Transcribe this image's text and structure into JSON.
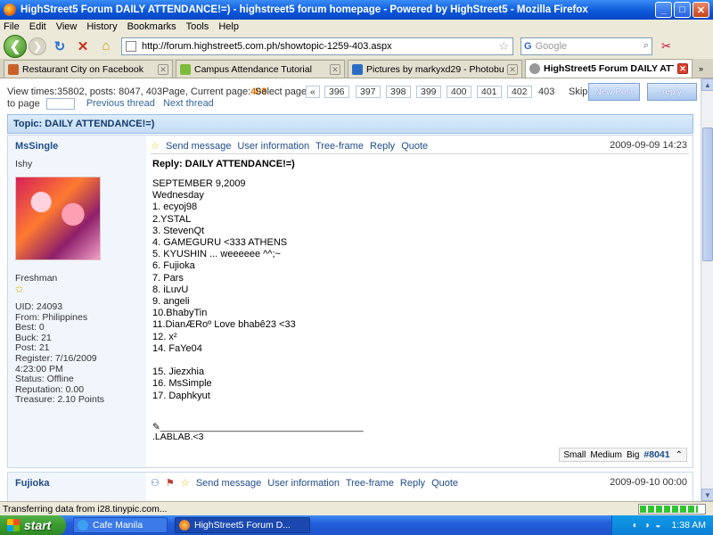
{
  "window": {
    "title": "HighStreet5 Forum DAILY ATTENDANCE!=) - highstreet5 forum homepage - Powered by HighStreet5 - Mozilla Firefox",
    "minimize": "_",
    "maximize": "□",
    "close": "✕"
  },
  "menu": [
    "File",
    "Edit",
    "View",
    "History",
    "Bookmarks",
    "Tools",
    "Help"
  ],
  "nav": {
    "url": "http://forum.highstreet5.com.ph/showtopic-1259-403.aspx",
    "search_placeholder": "Google"
  },
  "tabs": [
    {
      "label": "Restaurant City on Facebook",
      "color": "#c8602a"
    },
    {
      "label": "Campus Attendance Tutorial",
      "color": "#7cbc3a"
    },
    {
      "label": "Pictures by markyxd29 - Photobucket",
      "color": "#2d6cc4"
    },
    {
      "label": "HighStreet5 Forum DAILY ATTEN...",
      "color": "#ffffff"
    }
  ],
  "pager": {
    "view_info_prefix": "View times:35802, posts: 8047, 403Page, Current page:",
    "current_page": "403",
    "select_page_label": "Select page:",
    "first": "«",
    "pages": [
      "396",
      "397",
      "398",
      "399",
      "400",
      "401",
      "402"
    ],
    "current": "403",
    "skip_label": "Skip",
    "to_page_label": "to page",
    "prev_thread": "Previous thread",
    "next_thread": "Next thread",
    "new_post": "New Post",
    "reply": "reply"
  },
  "topic": {
    "title": "Topic: DAILY ATTENDANCE!=)"
  },
  "post1": {
    "username": "MsSingle",
    "subtitle": "Ishy",
    "rank": "Freshman",
    "stats": [
      "UID: 24093",
      "From: Philippines",
      "Best: 0",
      "Buck: 21",
      "Post: 21",
      "Register: 7/16/2009",
      "4:23:00 PM",
      "Status: Offline",
      "Reputation: 0.00",
      "Treasure: 2.10 Points"
    ],
    "actions": [
      "Send message",
      "User information",
      "Tree-frame",
      "Reply",
      "Quote"
    ],
    "date": "2009-09-09 14:23",
    "reply_title": "Reply: DAILY ATTENDANCE!=)",
    "body": "SEPTEMBER 9,2009\nWednesday\n1. ecyoj98\n2.YSTAL\n3. StevenQt\n4. GAMEGURU <333 ATHENS\n5. KYUSHIN ... weeeeee ^^;~\n6. Fujioka\n7. Pars\n8. iLuvU\n9. angeli\n10.BhabyTin\n11.DianÆRoº Love bhabê23 <33\n12. x²\n14. FaYe04\n\n15. Jiezxhia\n16. MsSimple\n17. Daphkyut",
    "signature": "✎_______________________________________\n.LABLAB.<3",
    "font_sizes": [
      "Small",
      "Medium",
      "Big"
    ],
    "post_no": "#8041"
  },
  "post2": {
    "username": "Fujioka",
    "actions": [
      "Send message",
      "User information",
      "Tree-frame",
      "Reply",
      "Quote"
    ],
    "date": "2009-09-10 00:00"
  },
  "status": {
    "text": "Transferring data from i28.tinypic.com...",
    "progress": 0.9
  },
  "taskbar": {
    "start": "start",
    "items": [
      "Cafe Manila",
      "HighStreet5 Forum D..."
    ],
    "clock": "1:38 AM"
  }
}
